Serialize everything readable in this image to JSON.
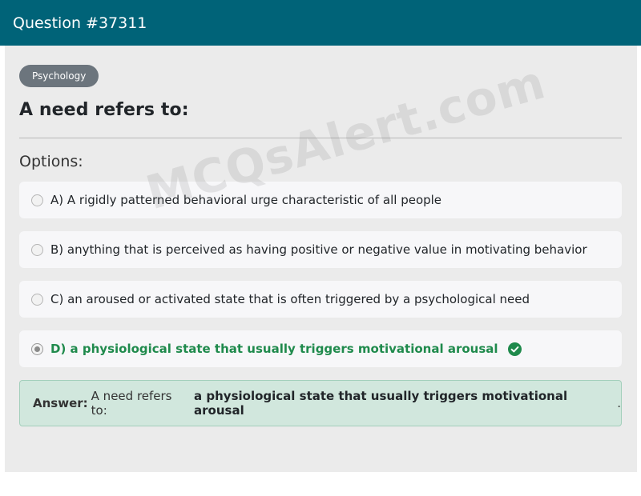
{
  "header": {
    "title": "Question #37311"
  },
  "question": {
    "category": "Psychology",
    "text": "A need refers to:"
  },
  "options_label": "Options:",
  "options": [
    {
      "label": "A) A rigidly patterned behavioral urge characteristic of all people",
      "selected": false,
      "correct": false
    },
    {
      "label": "B) anything that is perceived as having positive or negative value in motivating behavior",
      "selected": false,
      "correct": false
    },
    {
      "label": "C) an aroused or activated state that is often triggered by a psychological need",
      "selected": false,
      "correct": false
    },
    {
      "label": "D) a physiological state that usually triggers motivational arousal",
      "selected": true,
      "correct": true
    }
  ],
  "watermark": "MCQsAlert.com",
  "answer": {
    "label": "Answer:",
    "prefix": "A need refers to:",
    "value": "a physiological state that usually triggers motivational arousal",
    "suffix": "."
  },
  "colors": {
    "header_bg": "#006378",
    "correct_text": "#1f8a4c",
    "answer_bg": "#d1e7dd",
    "tag_bg": "#6c757d"
  },
  "icons": {
    "correct": "check-circle-icon"
  }
}
